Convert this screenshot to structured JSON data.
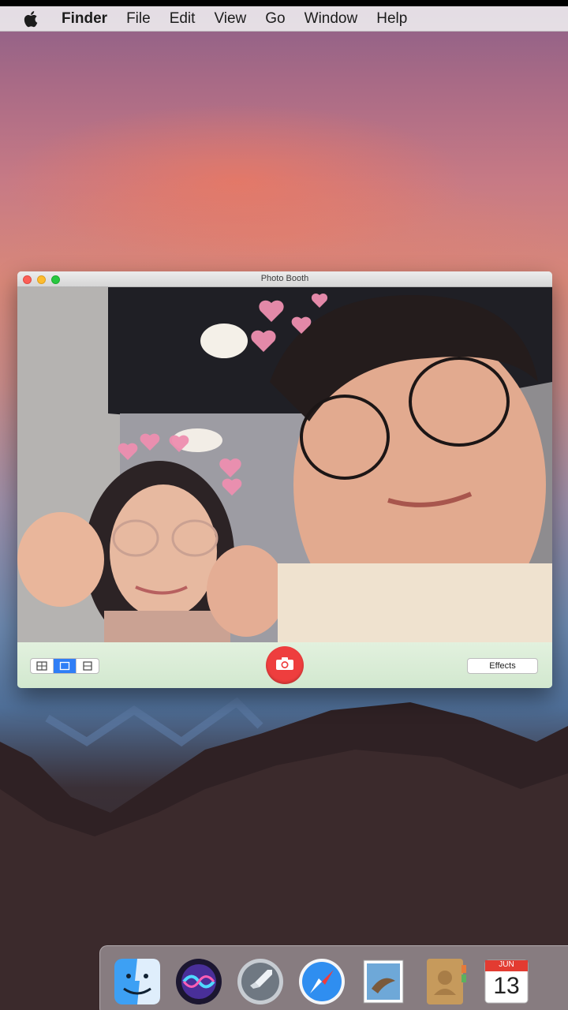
{
  "menubar": {
    "apple_icon": "apple-icon",
    "items": [
      "Finder",
      "File",
      "Edit",
      "View",
      "Go",
      "Window",
      "Help"
    ]
  },
  "window": {
    "title": "Photo Booth",
    "toolbar": {
      "effects_label": "Effects",
      "capture_icon": "camera-icon",
      "view_modes": [
        "four-up-icon",
        "single-icon",
        "filmstrip-icon"
      ],
      "active_view": "single-icon"
    }
  },
  "dock": {
    "apps": [
      "Finder",
      "Siri",
      "Launchpad",
      "Safari",
      "Mail",
      "Contacts",
      "Calendar"
    ],
    "calendar": {
      "month": "JUN",
      "day": "13"
    }
  },
  "colors": {
    "capture_button": "#ee3e3e",
    "toolbar_bg": "#dff0dc",
    "active_segment": "#2f7ef6"
  }
}
